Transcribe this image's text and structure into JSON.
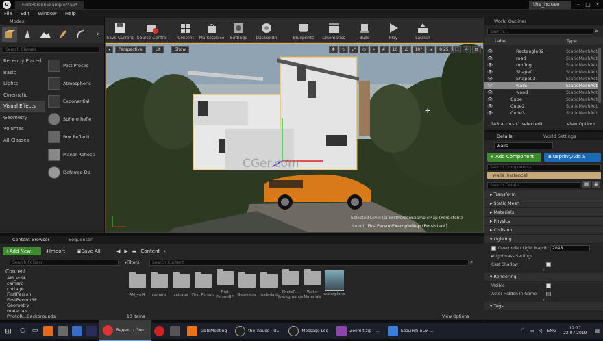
{
  "titlebar": {
    "tab": "FirstPersonExampleMap*",
    "project": "the_house",
    "minimize": "–",
    "maximize": "□",
    "close": "✕"
  },
  "menu": [
    "File",
    "Edit",
    "Window",
    "Help"
  ],
  "modes": {
    "title": "Modes",
    "search_placeholder": "Search Classes",
    "categories": [
      "Recently Placed",
      "Basic",
      "Lights",
      "Cinematic",
      "Visual Effects",
      "Geometry",
      "Volumes",
      "All Classes"
    ],
    "selected_category": "Visual Effects",
    "items": [
      "Post Proces",
      "Atmospheric",
      "Exponential",
      "Sphere Refle",
      "Box Reflecti",
      "Planar Reflecti",
      "Deferred De"
    ]
  },
  "toolbar": {
    "buttons": [
      "Save Current",
      "Source Control",
      "Content",
      "Marketplace",
      "Settings",
      "Datasmith",
      "Blueprints",
      "Cinematics",
      "Build",
      "Play",
      "Launch"
    ]
  },
  "viewport": {
    "perspective": "Perspective",
    "lit": "Lit",
    "show": "Show",
    "grid": "10",
    "rot": "10°",
    "scale": "0.25",
    "cam": "4",
    "level_label": "Level:",
    "level_name": "FirstPersonExampleMap (Persistent)",
    "overlay_level": "Selected Level (s) FirstPersonExampleMap (Persistent)",
    "watermark": "CGer.com"
  },
  "outliner": {
    "title": "World Outliner",
    "search_placeholder": "Search...",
    "col_label": "Label",
    "col_type": "Type",
    "rows": [
      {
        "name": "Rectangle02",
        "type": "StaticMeshAct"
      },
      {
        "name": "road",
        "type": "StaticMeshAct"
      },
      {
        "name": "roofing",
        "type": "StaticMeshAct"
      },
      {
        "name": "Shape01",
        "type": "StaticMeshAct"
      },
      {
        "name": "Shape03",
        "type": "StaticMeshAct"
      },
      {
        "name": "walls",
        "type": "StaticMeshAct"
      },
      {
        "name": "wood",
        "type": "StaticMeshAct"
      },
      {
        "name": "Cube",
        "type": "StaticMeshAct"
      },
      {
        "name": "Cube2",
        "type": "StaticMeshAct"
      },
      {
        "name": "Cube3",
        "type": "StaticMeshAct"
      }
    ],
    "selected_row": "walls",
    "status": "148 actors (1 selected)",
    "view_options": "View Options"
  },
  "details": {
    "tab1": "Details",
    "tab2": "World Settings",
    "name": "walls",
    "add_component": "+ Add Component",
    "blueprint": "Blueprint/Add S",
    "comp_search": "Search Components",
    "instance": "walls (Instance)",
    "search_details": "Search Details",
    "sections": [
      "Transform",
      "Static Mesh",
      "Materials",
      "Physics",
      "Collision",
      "Lighting",
      "Rendering",
      "Tags"
    ],
    "lighting_rows": {
      "override": "Overridden Light Map R",
      "override_val": "2048",
      "lightmass": "Lightmass Settings",
      "cast_shadow": "Cast Shadow"
    },
    "rendering_rows": {
      "visible": "Visible",
      "hidden": "Actor Hidden In Game"
    }
  },
  "content_browser": {
    "tab1": "Content Browser",
    "tab2": "Sequencer",
    "add_new": "Add New",
    "import": "Import",
    "save_all": "Save All",
    "path": "Content",
    "filters": "Filters",
    "search_folders": "Search Folders",
    "search_content": "Search Content",
    "tree": [
      "Content",
      "AM_vol4",
      "camaro",
      "cottage",
      "FirstPerson",
      "FirstPersonBP",
      "Geometry",
      "materials",
      "PhotoR...Backgrounds"
    ],
    "assets": [
      "AM_vol4",
      "camaro",
      "cottage",
      "First Person",
      "First PersonBP",
      "Geometry",
      "materials",
      "PhotoR... lbackgrounds",
      "Water Materials",
      "waterplane"
    ],
    "count": "10 items",
    "view_options": "View Options"
  },
  "taskbar": {
    "items": [
      "Яндекс - Goo...",
      "GoToMeeting",
      "the_house - U...",
      "Message Log",
      "Zoomlt.zip - ...",
      "Безымянный ..."
    ],
    "lang": "ENG",
    "time": "12:17",
    "date": "22.07.2019"
  }
}
